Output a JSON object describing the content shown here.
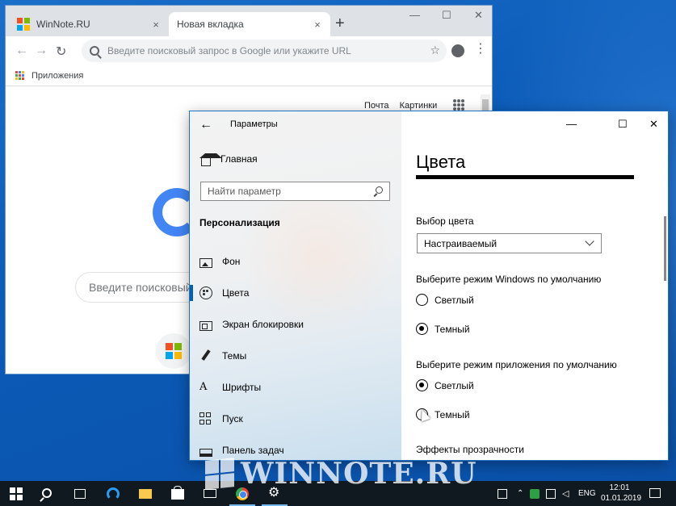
{
  "chrome": {
    "tabs": [
      {
        "title": "WinNote.RU",
        "close": "×"
      },
      {
        "title": "Новая вкладка",
        "close": "×"
      }
    ],
    "new_tab": "+",
    "window_controls": {
      "minimize": "—",
      "maximize": "☐",
      "close": "✕"
    },
    "omnibox_placeholder": "Введите поисковый запрос в Google или укажите URL",
    "bookmarks_apps": "Приложения",
    "google_links": {
      "mail": "Почта",
      "images": "Картинки"
    },
    "google_search_placeholder": "Введите поисковый з"
  },
  "settings": {
    "app_title": "Параметры",
    "nav": {
      "home": "Главная",
      "search_placeholder": "Найти параметр",
      "section": "Персонализация",
      "items": [
        {
          "label": "Фон",
          "icon": "picture-icon"
        },
        {
          "label": "Цвета",
          "icon": "palette-icon",
          "selected": true
        },
        {
          "label": "Экран блокировки",
          "icon": "lock-screen-icon"
        },
        {
          "label": "Темы",
          "icon": "brush-icon"
        },
        {
          "label": "Шрифты",
          "icon": "font-icon"
        },
        {
          "label": "Пуск",
          "icon": "start-icon"
        },
        {
          "label": "Панель задач",
          "icon": "taskbar-icon"
        }
      ]
    },
    "window_controls": {
      "minimize": "—",
      "maximize": "☐",
      "close": "✕"
    },
    "content": {
      "heading": "Цвета",
      "color_choice_label": "Выбор цвета",
      "color_choice_value": "Настраиваемый",
      "windows_mode_label": "Выберите режим Windows по умолчанию",
      "windows_mode_options": [
        {
          "label": "Светлый",
          "checked": false
        },
        {
          "label": "Темный",
          "checked": true
        }
      ],
      "app_mode_label": "Выберите режим приложения по умолчанию",
      "app_mode_options": [
        {
          "label": "Светлый",
          "checked": true
        },
        {
          "label": "Темный",
          "checked": false
        }
      ],
      "transparency_label": "Эффекты прозрачности"
    }
  },
  "watermark": {
    "text": "WINNOTE.RU"
  },
  "taskbar": {
    "language": "ENG",
    "time": "12:01",
    "date": "01.01.2019"
  },
  "colors": {
    "accent_blue": "#0063b1",
    "desktop_blue": "#0b5bb8",
    "taskbar": "#101820"
  }
}
